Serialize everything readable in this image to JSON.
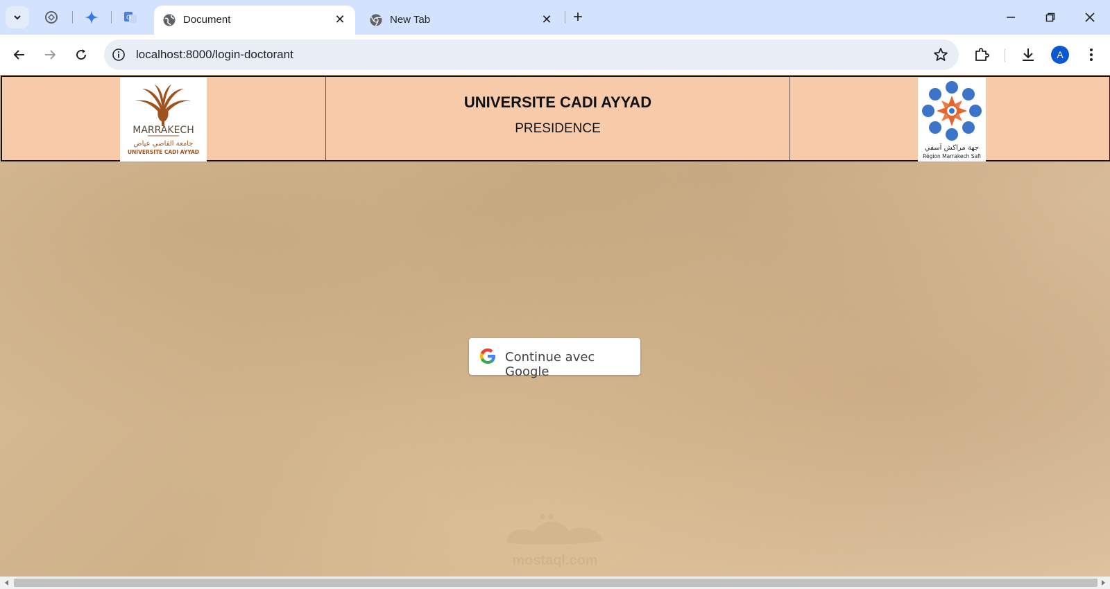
{
  "browser": {
    "tabs": [
      {
        "title": "Document",
        "active": true
      },
      {
        "title": "New Tab",
        "active": false
      }
    ],
    "close_glyph": "✕",
    "new_tab_glyph": "+",
    "address": "localhost:8000/login-doctorant",
    "avatar_letter": "A",
    "accent_color": "#0b57d0"
  },
  "header": {
    "title": "UNIVERSITE CADI AYYAD",
    "subtitle": "PRESIDENCE",
    "left_logo": {
      "city": "MARRAKECH",
      "arabic": "جامعة القاضي عياض",
      "name": "UNIVERSITE CADI AYYAD"
    },
    "right_logo": {
      "arabic": "جهة مراكش آسفي",
      "name": "Région Marrakech Safi"
    },
    "background_color": "#f7cbaa"
  },
  "login": {
    "google_button_label": "Continue avec Google"
  },
  "watermark": {
    "text": "mostaql.com"
  }
}
